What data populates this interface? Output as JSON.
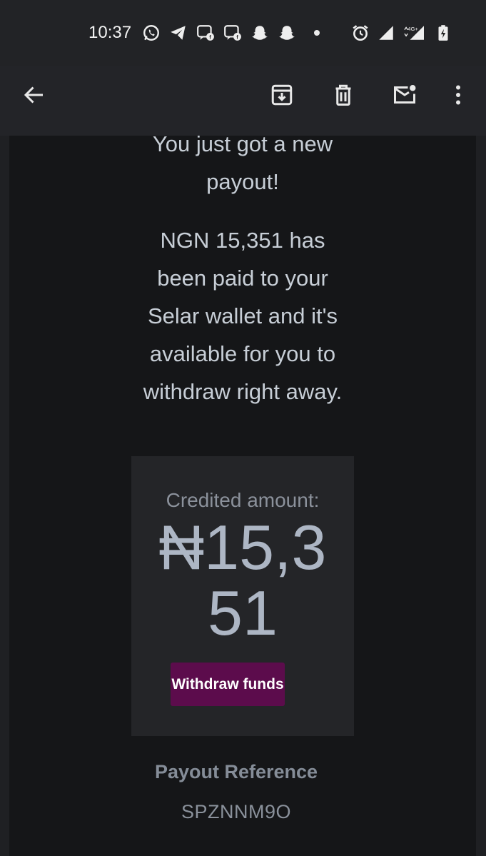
{
  "status_bar": {
    "time": "10:37",
    "left_icons": [
      "whatsapp-icon",
      "telegram-icon",
      "messenger-icon",
      "messenger-icon",
      "snapchat-icon",
      "snapchat-icon"
    ],
    "right_icons": [
      "alarm-icon",
      "signal-icon",
      "4g-signal-icon",
      "battery-icon"
    ],
    "network_label": "4G+"
  },
  "app_bar": {
    "back": "arrow-back-icon",
    "actions": [
      "archive-icon",
      "delete-icon",
      "mark-unread-icon",
      "more-vert-icon"
    ]
  },
  "email": {
    "headline_lines": [
      "You just got a new",
      "payout!"
    ],
    "body_lines": [
      "NGN 15,351 has",
      "been paid to your",
      "Selar wallet and it's",
      "available for you to",
      "withdraw right away."
    ],
    "credited_label": "Credited amount:",
    "credited_amount_lines": [
      "₦15,3",
      "51"
    ],
    "withdraw_label": "Withdraw funds",
    "reference_title": "Payout Reference",
    "reference_value": "SPZNNM9O"
  },
  "colors": {
    "withdraw_button": "#5c0c4c",
    "content_bg": "#151618",
    "card_bg": "#242528"
  }
}
